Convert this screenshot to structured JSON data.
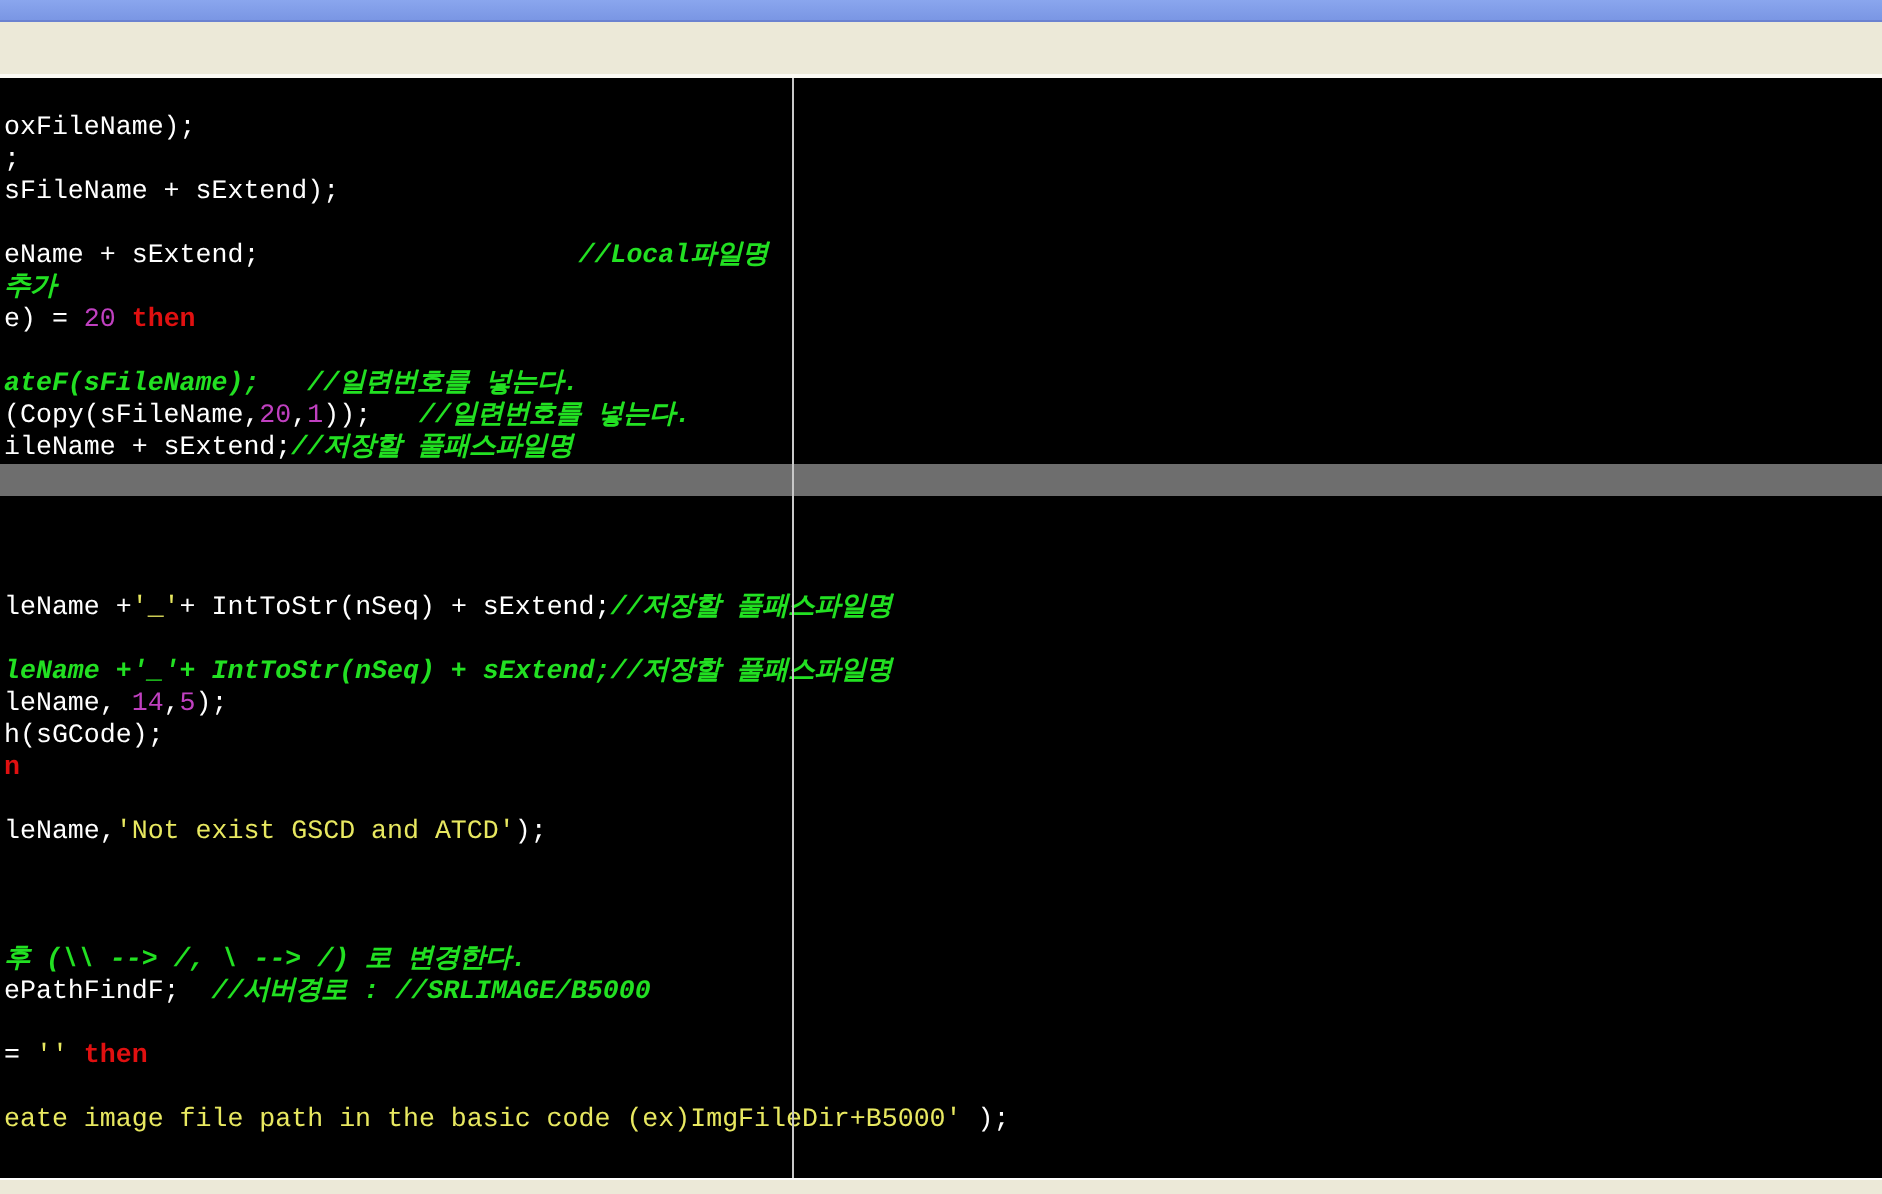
{
  "editor": {
    "lines": [
      {
        "kind": "code",
        "segments": [
          {
            "kind": "plain",
            "text": "oxFileName);"
          }
        ]
      },
      {
        "kind": "code",
        "segments": [
          {
            "kind": "plain",
            "text": ";"
          }
        ]
      },
      {
        "kind": "code",
        "segments": [
          {
            "kind": "plain",
            "text": "sFileName + sExtend);"
          }
        ]
      },
      {
        "kind": "blank"
      },
      {
        "kind": "code",
        "segments": [
          {
            "kind": "plain",
            "text": "eName + sExtend;                    "
          },
          {
            "kind": "comment",
            "text": "//Local파일명"
          }
        ]
      },
      {
        "kind": "code",
        "segments": [
          {
            "kind": "comment",
            "text": "추가"
          }
        ]
      },
      {
        "kind": "code",
        "segments": [
          {
            "kind": "plain",
            "text": "e) = "
          },
          {
            "kind": "number",
            "text": "20"
          },
          {
            "kind": "keyword",
            "text": " then"
          }
        ]
      },
      {
        "kind": "blank"
      },
      {
        "kind": "code",
        "segments": [
          {
            "kind": "comment",
            "text": "ateF(sFileName);   //일련번호를 넣는다."
          }
        ]
      },
      {
        "kind": "code",
        "segments": [
          {
            "kind": "plain",
            "text": "(Copy(sFileName,"
          },
          {
            "kind": "number",
            "text": "20"
          },
          {
            "kind": "plain",
            "text": ","
          },
          {
            "kind": "number",
            "text": "1"
          },
          {
            "kind": "plain",
            "text": "));   "
          },
          {
            "kind": "comment",
            "text": "//일련번호를 넣는다."
          }
        ]
      },
      {
        "kind": "code",
        "segments": [
          {
            "kind": "plain",
            "text": "ileName + sExtend;"
          },
          {
            "kind": "comment",
            "text": "//저장할 풀패스파일명"
          }
        ]
      },
      {
        "kind": "current"
      },
      {
        "kind": "blank"
      },
      {
        "kind": "blank"
      },
      {
        "kind": "blank"
      },
      {
        "kind": "code",
        "segments": [
          {
            "kind": "plain",
            "text": "leName +"
          },
          {
            "kind": "string",
            "text": "'_'"
          },
          {
            "kind": "plain",
            "text": "+ IntToStr(nSeq) + sExtend;"
          },
          {
            "kind": "comment",
            "text": "//저장할 풀패스파일명"
          }
        ]
      },
      {
        "kind": "blank"
      },
      {
        "kind": "code",
        "segments": [
          {
            "kind": "comment",
            "text": "leName +'_'+ IntToStr(nSeq) + sExtend;//저장할 풀패스파일명"
          }
        ]
      },
      {
        "kind": "code",
        "segments": [
          {
            "kind": "plain",
            "text": "leName, "
          },
          {
            "kind": "number",
            "text": "14"
          },
          {
            "kind": "plain",
            "text": ","
          },
          {
            "kind": "number",
            "text": "5"
          },
          {
            "kind": "plain",
            "text": ");"
          }
        ]
      },
      {
        "kind": "code",
        "segments": [
          {
            "kind": "plain",
            "text": "h(sGCode);"
          }
        ]
      },
      {
        "kind": "code",
        "segments": [
          {
            "kind": "keyword",
            "text": "n"
          }
        ]
      },
      {
        "kind": "blank"
      },
      {
        "kind": "code",
        "segments": [
          {
            "kind": "plain",
            "text": "leName,"
          },
          {
            "kind": "string",
            "text": "'Not exist GSCD and ATCD'"
          },
          {
            "kind": "plain",
            "text": ");"
          }
        ]
      },
      {
        "kind": "blank"
      },
      {
        "kind": "blank"
      },
      {
        "kind": "blank"
      },
      {
        "kind": "code",
        "segments": [
          {
            "kind": "comment",
            "text": "후 (\\\\ --> /, \\ --> /) 로 변경한다."
          }
        ]
      },
      {
        "kind": "code",
        "segments": [
          {
            "kind": "plain",
            "text": "ePathFindF;  "
          },
          {
            "kind": "comment",
            "text": "//서버경로 : //SRLIMAGE/B5000"
          }
        ]
      },
      {
        "kind": "blank"
      },
      {
        "kind": "code",
        "segments": [
          {
            "kind": "plain",
            "text": "= "
          },
          {
            "kind": "string",
            "text": "''"
          },
          {
            "kind": "keyword",
            "text": " then"
          }
        ]
      },
      {
        "kind": "blank"
      },
      {
        "kind": "code",
        "segments": [
          {
            "kind": "string",
            "text": "eate image file path in the basic code (ex)ImgFileDir+B5000'"
          },
          {
            "kind": "plain",
            "text": " );"
          }
        ]
      }
    ]
  }
}
